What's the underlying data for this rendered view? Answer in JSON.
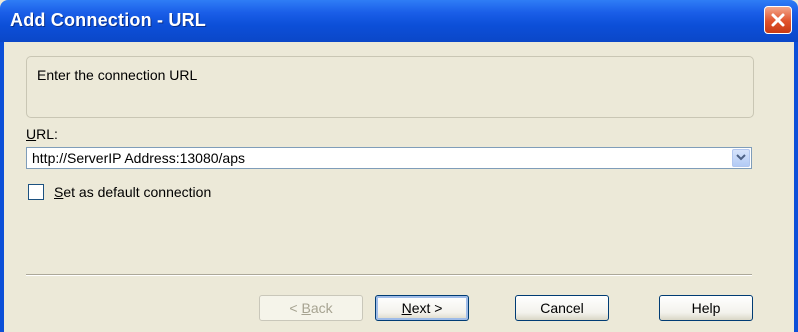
{
  "window": {
    "title": "Add Connection - URL"
  },
  "info": {
    "text": "Enter the connection URL"
  },
  "url": {
    "label_accel": "U",
    "label_rest": "RL:",
    "value": "http://ServerIP Address:13080/aps"
  },
  "default_checkbox": {
    "checked": false,
    "label_accel": "S",
    "label_rest": "et as default connection"
  },
  "buttons": {
    "back": {
      "prefix": "< ",
      "accel": "B",
      "rest": "ack"
    },
    "next": {
      "accel": "N",
      "rest": "ext >"
    },
    "cancel": "Cancel",
    "help": "Help"
  },
  "colors": {
    "titlebar": "#0c4fd8",
    "close": "#e0522b",
    "face": "#ece9d8"
  },
  "icons": {
    "close": "close-icon",
    "combo": "chevron-down-icon"
  }
}
